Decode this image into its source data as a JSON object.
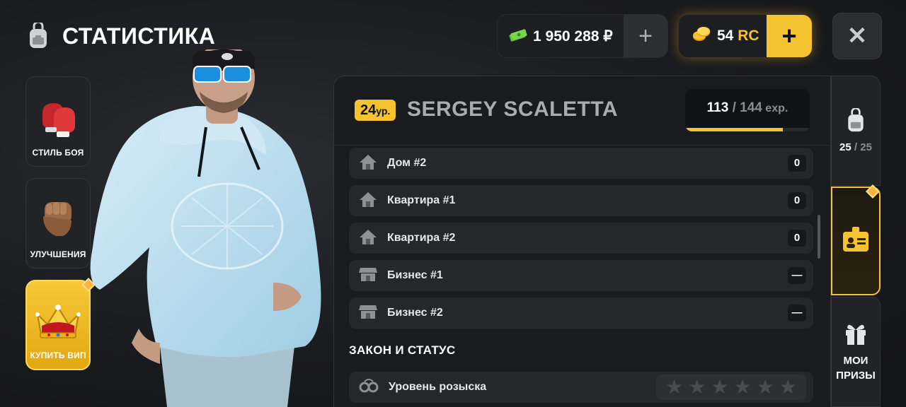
{
  "header": {
    "title": "СТАТИСТИКА",
    "icon": "backpack-icon"
  },
  "currency": {
    "money": "1 950 288 ₽",
    "money_add": "+",
    "rc_amount": "54",
    "rc_unit": "RC",
    "rc_add": "+",
    "accent": "#f5c230"
  },
  "close_label": "✕",
  "sidebar": {
    "items": [
      {
        "label": "СТИЛЬ БОЯ",
        "icon": "boxing-gloves-icon"
      },
      {
        "label": "УЛУЧШЕНИЯ",
        "icon": "fist-icon"
      },
      {
        "label": "КУПИТЬ ВИП",
        "icon": "crown-icon"
      }
    ]
  },
  "player": {
    "level": "24",
    "level_suffix": "ур.",
    "name": "SERGEY SCALETTA",
    "exp_current": "113",
    "exp_sep": " / ",
    "exp_max": "144",
    "exp_unit": " exp.",
    "exp_fraction": 0.785
  },
  "property": [
    {
      "label": "Дом #2",
      "value": "0",
      "icon": "house-icon"
    },
    {
      "label": "Квартира #1",
      "value": "0",
      "icon": "house-icon"
    },
    {
      "label": "Квартира #2",
      "value": "0",
      "icon": "house-icon"
    },
    {
      "label": "Бизнес #1",
      "value": "—",
      "icon": "shop-icon"
    },
    {
      "label": "Бизнес #2",
      "value": "—",
      "icon": "shop-icon"
    }
  ],
  "law": {
    "title": "ЗАКОН И СТАТУС",
    "wanted_label": "Уровень розыска",
    "wanted_icon": "handcuffs-icon",
    "wanted_stars": 0,
    "wanted_max": 6
  },
  "right_tabs": {
    "inventory": {
      "icon": "backpack-icon",
      "count": "25",
      "sep": " / ",
      "max": "25"
    },
    "card": {
      "icon": "id-card-icon"
    },
    "gifts": {
      "icon": "gift-icon",
      "label_line1": "МОИ",
      "label_line2": "ПРИЗЫ"
    }
  }
}
